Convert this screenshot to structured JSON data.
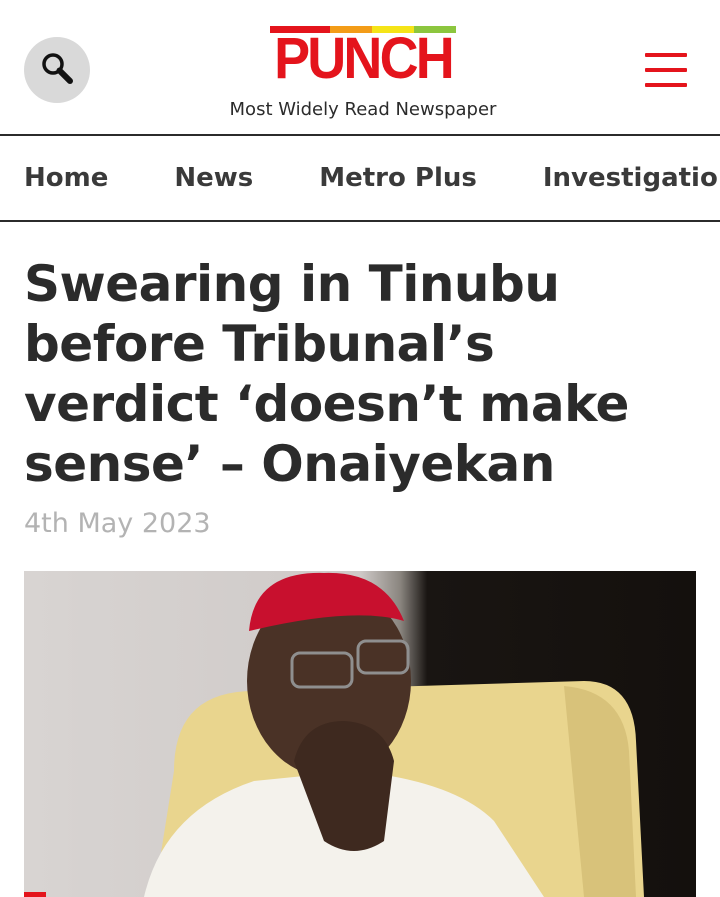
{
  "header": {
    "logo_text": "PUNCH",
    "tagline": "Most Widely Read Newspaper",
    "logo_stripe_colors": [
      "#e4141c",
      "#f39c18",
      "#f5e418",
      "#8cc63e"
    ],
    "brand_color": "#e4141c"
  },
  "icons": {
    "search": "search-icon",
    "menu": "hamburger-menu-icon"
  },
  "nav": {
    "items": [
      {
        "label": "Home"
      },
      {
        "label": "News"
      },
      {
        "label": "Metro Plus"
      },
      {
        "label": "Investigation"
      }
    ]
  },
  "article": {
    "headline": "Swearing in Tinubu before Tribunal’s verdict ‘doesn’t make sense’ – Onaiyekan",
    "date": "4th May 2023"
  }
}
